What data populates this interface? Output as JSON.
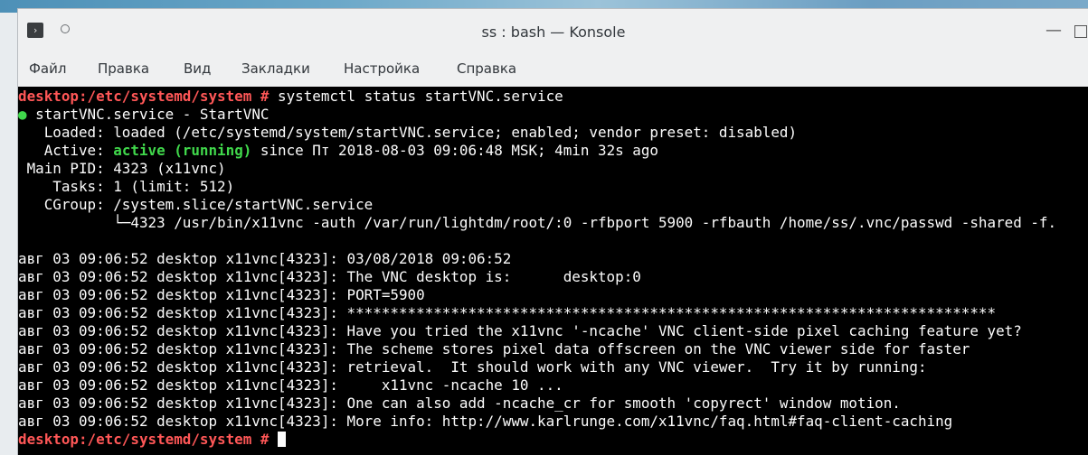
{
  "window": {
    "title": "ss : bash — Konsole",
    "icon": "konsole-icon"
  },
  "menu": [
    "Файл",
    "Правка",
    "Вид",
    "Закладки",
    "Настройка",
    "Справка"
  ],
  "terminal": {
    "prompt": "desktop:/etc/systemd/system #",
    "command": " systemctl status startVNC.service",
    "status_dot": "●",
    "service_line": " startVNC.service - StartVNC",
    "loaded": "   Loaded: loaded (/etc/systemd/system/startVNC.service; enabled; vendor preset: disabled)",
    "active_prefix": "   Active: ",
    "active_state": "active (running)",
    "active_suffix": " since Пт 2018-08-03 09:06:48 MSK; 4min 32s ago",
    "main_pid": " Main PID: 4323 (x11vnc)",
    "tasks": "    Tasks: 1 (limit: 512)",
    "cgroup": "   CGroup: /system.slice/startVNC.service",
    "cgroup_child": "           └─4323 /usr/bin/x11vnc -auth /var/run/lightdm/root/:0 -rfbport 5900 -rfbauth /home/ss/.vnc/passwd -shared -f.",
    "log_lines": [
      "авг 03 09:06:52 desktop x11vnc[4323]: 03/08/2018 09:06:52",
      "авг 03 09:06:52 desktop x11vnc[4323]: The VNC desktop is:      desktop:0",
      "авг 03 09:06:52 desktop x11vnc[4323]: PORT=5900",
      "авг 03 09:06:52 desktop x11vnc[4323]: ***************************************************************************",
      "авг 03 09:06:52 desktop x11vnc[4323]: Have you tried the x11vnc '-ncache' VNC client-side pixel caching feature yet?",
      "авг 03 09:06:52 desktop x11vnc[4323]: The scheme stores pixel data offscreen on the VNC viewer side for faster",
      "авг 03 09:06:52 desktop x11vnc[4323]: retrieval.  It should work with any VNC viewer.  Try it by running:",
      "авг 03 09:06:52 desktop x11vnc[4323]:     x11vnc -ncache 10 ...",
      "авг 03 09:06:52 desktop x11vnc[4323]: One can also add -ncache_cr for smooth 'copyrect' window motion.",
      "авг 03 09:06:52 desktop x11vnc[4323]: More info: http://www.karlrunge.com/x11vnc/faq.html#faq-client-caching"
    ]
  },
  "colors": {
    "prompt": "#ff5757",
    "active": "#40d84b",
    "background": "#000000",
    "foreground": "#fcfcfc"
  }
}
